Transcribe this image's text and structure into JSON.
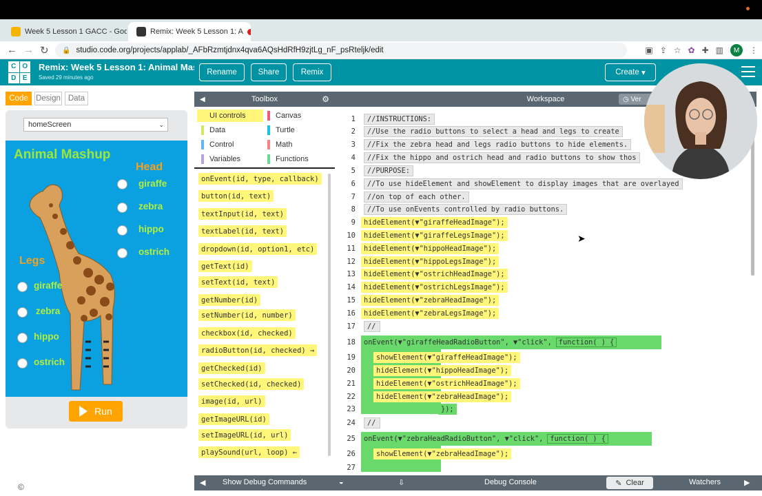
{
  "browser": {
    "tabs": [
      {
        "label": "Week 5 Lesson 1 GACC - Goo"
      },
      {
        "label": "Remix: Week 5 Lesson 1: A"
      }
    ],
    "url": "studio.code.org/projects/applab/_AFbRzmtjdnx4qva6AQsHdRfH9zjtLg_nF_psRteljk/edit",
    "profile_initial": "M"
  },
  "header": {
    "logo": [
      "C",
      "O",
      "D",
      "E"
    ],
    "title": "Remix: Week 5 Lesson 1: Animal Mas...",
    "saved": "Saved 29 minutes ago",
    "buttons": {
      "rename": "Rename",
      "share": "Share",
      "remix": "Remix",
      "create": "Create"
    }
  },
  "left": {
    "tabs": {
      "code": "Code",
      "design": "Design",
      "data": "Data"
    },
    "screen_select": "homeScreen",
    "app": {
      "title": "Animal Mashup",
      "head_label": "Head",
      "legs_label": "Legs",
      "head_options": [
        "giraffe",
        "zebra",
        "hippo",
        "ostrich"
      ],
      "leg_options": [
        "giraffe",
        "zebra",
        "hippo",
        "ostrich"
      ]
    },
    "run_label": "Run"
  },
  "toolbox": {
    "title": "Toolbox",
    "categories": [
      {
        "label": "UI controls",
        "color": "#fff67a"
      },
      {
        "label": "Canvas",
        "color": "#f05a72"
      },
      {
        "label": "Data",
        "color": "#d3e965"
      },
      {
        "label": "Turtle",
        "color": "#19c3e1"
      },
      {
        "label": "Control",
        "color": "#64b5f6"
      },
      {
        "label": "Math",
        "color": "#f78183"
      },
      {
        "label": "Variables",
        "color": "#b6a2e0"
      },
      {
        "label": "Functions",
        "color": "#68d995"
      }
    ],
    "blocks": [
      "onEvent(id, type, callback)",
      "button(id, text)",
      "textInput(id, text)",
      "textLabel(id, text)",
      "dropdown(id, option1, etc)",
      "getText(id)",
      "setText(id, text)",
      "getNumber(id)",
      "setNumber(id, number)",
      "checkbox(id, checked)",
      "radioButton(id, checked) →",
      "getChecked(id)",
      "setChecked(id, checked)",
      "image(id, url)",
      "getImageURL(id)",
      "setImageURL(id, url)",
      "playSound(url, loop) ←"
    ]
  },
  "workspace": {
    "title": "Workspace",
    "version_label": "Ver",
    "line_numbers": [
      "1",
      "2",
      "3",
      "4",
      "5",
      "6",
      "7",
      "8",
      "9",
      "10",
      "11",
      "12",
      "13",
      "14",
      "15",
      "16",
      "17",
      "18",
      "19",
      "20",
      "21",
      "22",
      "23",
      "24",
      "25",
      "26",
      "27"
    ],
    "comments": [
      "//INSTRUCTIONS:",
      "//Use the radio buttons to select a head and legs to create",
      "//Fix the zebra head and legs radio buttons to hide elements.",
      "//Fix the hippo and ostrich head and radio buttons to show thos",
      "//PURPOSE:",
      "//To use hideElement and showElement to display images that are overlayed",
      "//on top of each other.",
      "//To use onEvents controlled by radio buttons."
    ],
    "hide_lines": [
      "hideElement(▼\"giraffeHeadImage\");",
      "hideElement(▼\"giraffeLegsImage\");",
      "hideElement(▼\"hippoHeadImage\");",
      "hideElement(▼\"hippoLegsImage\");",
      "hideElement(▼\"ostrichHeadImage\");",
      "hideElement(▼\"ostrichLegsImage\");",
      "hideElement(▼\"zebraHeadImage\");",
      "hideElement(▼\"zebraLegsImage\");"
    ],
    "empty_comment": "//",
    "event1": {
      "head": "onEvent(▼\"giraffeHeadRadioButton\", ▼\"click\",",
      "fn": "function( ) {",
      "body": [
        "showElement(▼\"giraffeHeadImage\");",
        "hideElement(▼\"hippoHeadImage\");",
        "hideElement(▼\"ostrichHeadImage\");",
        "hideElement(▼\"zebraHeadImage\");"
      ],
      "close": "});"
    },
    "event2": {
      "head": "onEvent(▼\"zebraHeadRadioButton\", ▼\"click\",",
      "fn": "function( ) {",
      "body": [
        "showElement(▼\"zebraHeadImage\");"
      ]
    }
  },
  "bottombar": {
    "show_debug": "Show Debug Commands",
    "debug_console": "Debug Console",
    "clear": "Clear",
    "watchers": "Watchers"
  }
}
